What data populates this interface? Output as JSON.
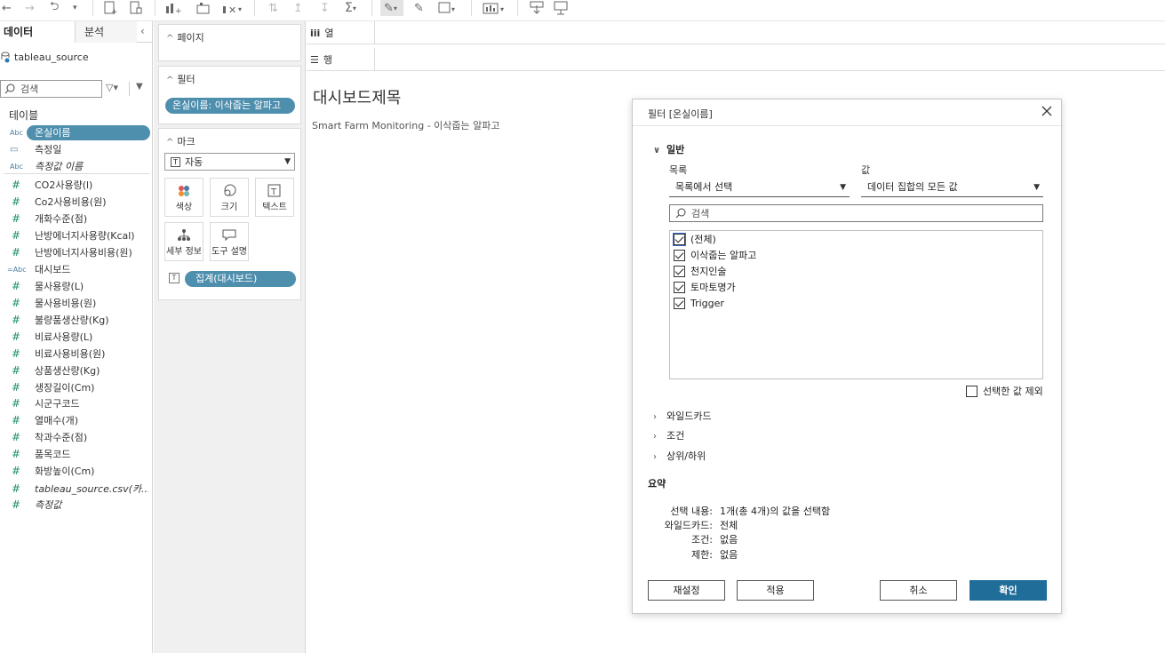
{
  "datapane": {
    "tabs": [
      "데이터",
      "분석"
    ],
    "source": "tableau_source",
    "search_placeholder": "검색",
    "tables_heading": "테이블",
    "fields": [
      {
        "type": "Abc",
        "label": "온실이름",
        "style": "pill"
      },
      {
        "type": "date",
        "label": "측정일",
        "style": ""
      },
      {
        "type": "Abc",
        "label": "측정값 이름",
        "style": "italic"
      },
      {
        "type": "#",
        "label": "CO2사용량(l)",
        "style": ""
      },
      {
        "type": "#",
        "label": "Co2사용비용(원)",
        "style": ""
      },
      {
        "type": "#",
        "label": "개화수준(점)",
        "style": ""
      },
      {
        "type": "#",
        "label": "난방에너지사용량(Kcal)",
        "style": ""
      },
      {
        "type": "#",
        "label": "난방에너지사용비용(원)",
        "style": ""
      },
      {
        "type": "=Abc",
        "label": "대시보드",
        "style": ""
      },
      {
        "type": "#",
        "label": "물사용량(L)",
        "style": ""
      },
      {
        "type": "#",
        "label": "물사용비용(원)",
        "style": ""
      },
      {
        "type": "#",
        "label": "불량품생산량(Kg)",
        "style": ""
      },
      {
        "type": "#",
        "label": "비료사용량(L)",
        "style": ""
      },
      {
        "type": "#",
        "label": "비료사용비용(원)",
        "style": ""
      },
      {
        "type": "#",
        "label": "상품생산량(Kg)",
        "style": ""
      },
      {
        "type": "#",
        "label": "생장길이(Cm)",
        "style": ""
      },
      {
        "type": "#",
        "label": "시군구코드",
        "style": ""
      },
      {
        "type": "#",
        "label": "열매수(개)",
        "style": ""
      },
      {
        "type": "#",
        "label": "착과수준(점)",
        "style": ""
      },
      {
        "type": "#",
        "label": "품목코드",
        "style": ""
      },
      {
        "type": "#",
        "label": "화방높이(Cm)",
        "style": ""
      },
      {
        "type": "#",
        "label": "tableau_source.csv(카...",
        "style": "italic"
      },
      {
        "type": "#",
        "label": "측정값",
        "style": "italic"
      }
    ]
  },
  "shelves": {
    "pages": "페이지",
    "filters": "필터",
    "filter_pill": "온실이름: 이삭줍는 알파고",
    "marks": "마크",
    "mark_type": "자동",
    "mark_buttons": [
      "색상",
      "크기",
      "텍스트",
      "세부 정보",
      "도구 설명"
    ],
    "agg_pill": "집계(대시보드)",
    "columns": "열",
    "rows": "행"
  },
  "sheet": {
    "title": "대시보드제목",
    "subtitle": "Smart Farm Monitoring - 이삭줍는 알파고"
  },
  "dialog": {
    "title": "필터 [온실이름]",
    "general": "일반",
    "list_label": "목록",
    "value_label": "값",
    "list_mode": "목록에서 선택",
    "value_mode": "데이터 집합의 모든 값",
    "search_placeholder": "검색",
    "items": [
      {
        "label": "(전체)",
        "checked": true
      },
      {
        "label": "이삭줍는 알파고",
        "checked": true
      },
      {
        "label": "천지인술",
        "checked": true
      },
      {
        "label": "토마토명가",
        "checked": true
      },
      {
        "label": "Trigger",
        "checked": true
      }
    ],
    "exclude_label": "선택한 값 제외",
    "wildcard": "와일드카드",
    "condition": "조건",
    "topbottom": "상위/하위",
    "summary_heading": "요약",
    "summary": [
      {
        "k": "선택 내용:",
        "v": "1개(총 4개)의 값을 선택함"
      },
      {
        "k": "와일드카드:",
        "v": "전체"
      },
      {
        "k": "조건:",
        "v": "없음"
      },
      {
        "k": "제한:",
        "v": "없음"
      }
    ],
    "buttons": {
      "reset": "재설정",
      "apply": "적용",
      "cancel": "취소",
      "ok": "확인"
    }
  },
  "colors": {
    "accent": "#4f8fae",
    "primary_button": "#1f6d98"
  }
}
